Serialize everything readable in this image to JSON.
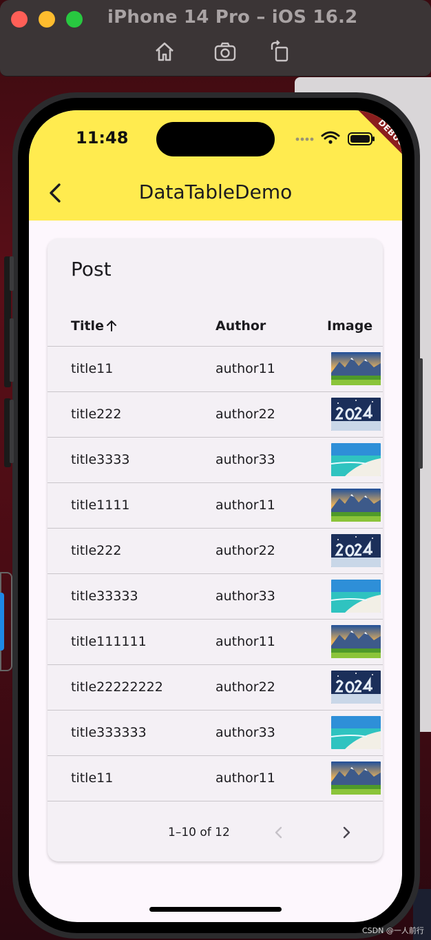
{
  "simulator": {
    "title": "iPhone 14 Pro – iOS 16.2",
    "toolbar": [
      "home-icon",
      "screenshot-icon",
      "rotate-icon"
    ]
  },
  "status_bar": {
    "time": "11:48",
    "debug_badge": "DEBUG"
  },
  "app_bar": {
    "title": "DataTableDemo",
    "background": "#ffeb4f"
  },
  "card": {
    "header": "Post",
    "columns": [
      {
        "label": "Title",
        "sorted": "ascending"
      },
      {
        "label": "Author"
      },
      {
        "label": "Image"
      }
    ],
    "rows": [
      {
        "title": "title11",
        "author": "author11",
        "image": "mountains"
      },
      {
        "title": "title222",
        "author": "author22",
        "image": "2024"
      },
      {
        "title": "title3333",
        "author": "author33",
        "image": "beach"
      },
      {
        "title": "title1111",
        "author": "author11",
        "image": "mountains"
      },
      {
        "title": "title222",
        "author": "author22",
        "image": "2024"
      },
      {
        "title": "title33333",
        "author": "author33",
        "image": "beach"
      },
      {
        "title": "title111111",
        "author": "author11",
        "image": "mountains"
      },
      {
        "title": "title22222222",
        "author": "author22",
        "image": "2024"
      },
      {
        "title": "title333333",
        "author": "author33",
        "image": "beach"
      },
      {
        "title": "title11",
        "author": "author11",
        "image": "mountains"
      }
    ],
    "pagination": {
      "label": "1–10 of 12",
      "prev_enabled": false,
      "next_enabled": true
    }
  },
  "watermark": "CSDN @一人前行"
}
